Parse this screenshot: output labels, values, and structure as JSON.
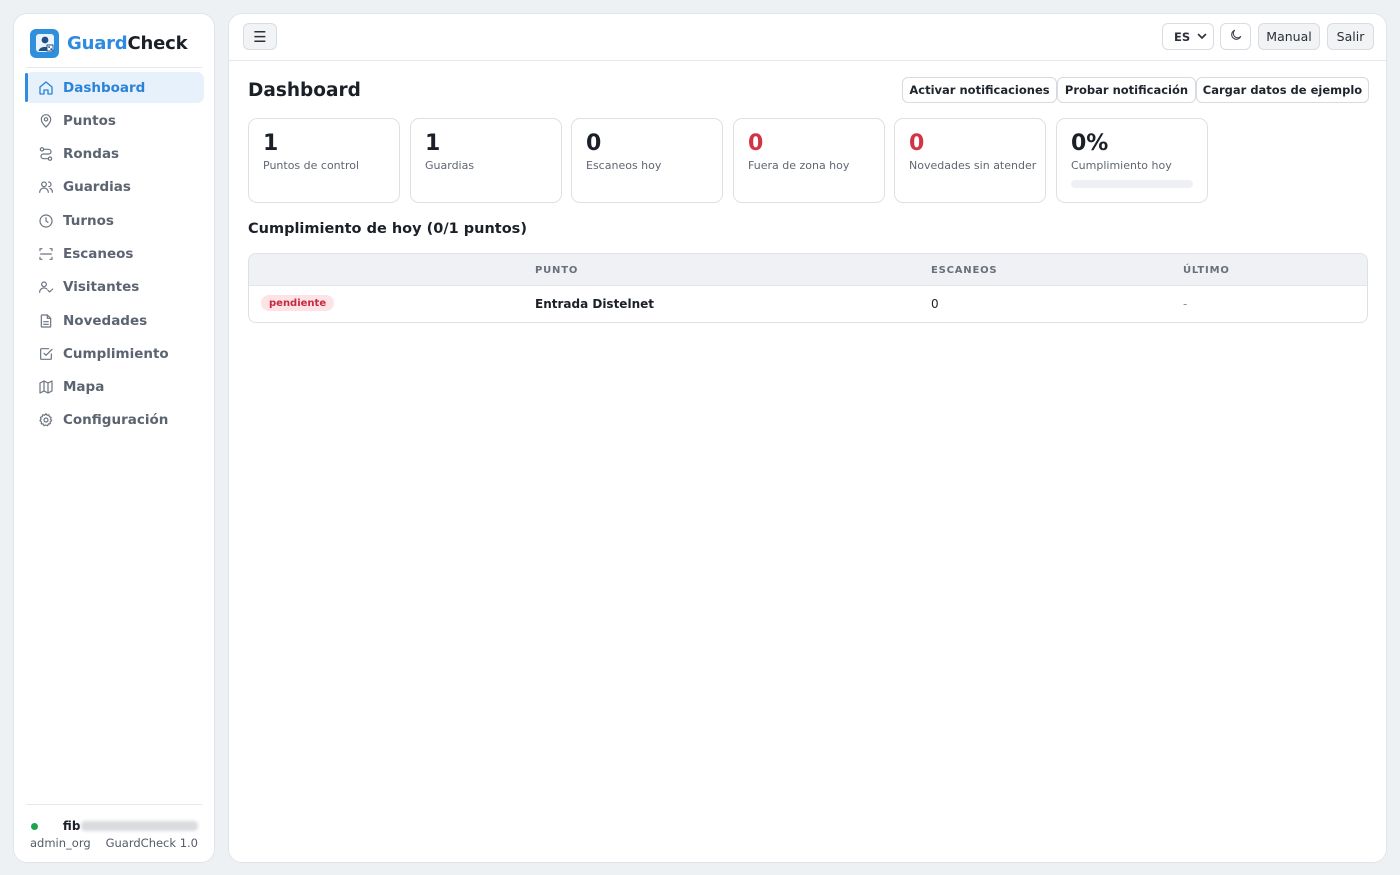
{
  "app": {
    "brand_primary": "Guard",
    "brand_secondary": "Check",
    "accent_color": "#2e8be0",
    "danger_color": "#d23446",
    "success_color": "#1ea44f"
  },
  "sidebar": {
    "items": [
      {
        "label": "Dashboard",
        "icon": "home-icon",
        "active": true
      },
      {
        "label": "Puntos",
        "icon": "map-pin-icon",
        "active": false
      },
      {
        "label": "Rondas",
        "icon": "route-icon",
        "active": false
      },
      {
        "label": "Guardias",
        "icon": "users-icon",
        "active": false
      },
      {
        "label": "Turnos",
        "icon": "clock-icon",
        "active": false
      },
      {
        "label": "Escaneos",
        "icon": "scan-icon",
        "active": false
      },
      {
        "label": "Visitantes",
        "icon": "user-check-icon",
        "active": false
      },
      {
        "label": "Novedades",
        "icon": "document-icon",
        "active": false
      },
      {
        "label": "Cumplimiento",
        "icon": "checkbox-icon",
        "active": false
      },
      {
        "label": "Mapa",
        "icon": "map-icon",
        "active": false
      },
      {
        "label": "Configuración",
        "icon": "gear-icon",
        "active": false
      }
    ],
    "footer": {
      "user_name": "fib",
      "role": "admin_org",
      "version": "GuardCheck 1.0"
    }
  },
  "topbar": {
    "menu_icon": "☰",
    "language": "ES",
    "theme_icon": "moon-icon",
    "manual_label": "Manual",
    "logout_label": "Salir"
  },
  "page": {
    "title": "Dashboard",
    "actions": {
      "enable_notifications": "Activar notificaciones",
      "test_notification": "Probar notificación",
      "load_sample": "Cargar datos de ejemplo"
    }
  },
  "stats": [
    {
      "value": "1",
      "label": "Puntos de control",
      "highlight": false
    },
    {
      "value": "1",
      "label": "Guardias",
      "highlight": false
    },
    {
      "value": "0",
      "label": "Escaneos hoy",
      "highlight": false
    },
    {
      "value": "0",
      "label": "Fuera de zona hoy",
      "highlight": true
    },
    {
      "value": "0",
      "label": "Novedades sin atender",
      "highlight": true
    },
    {
      "value": "0%",
      "label": "Cumplimiento hoy",
      "highlight": false,
      "progress": 0
    }
  ],
  "compliance": {
    "title": "Cumplimiento de hoy (0/1 puntos)",
    "columns": [
      "",
      "PUNTO",
      "ESCANEOS",
      "ÚLTIMO"
    ],
    "rows": [
      {
        "status": "pendiente",
        "point": "Entrada Distelnet",
        "scans": "0",
        "last": "-"
      }
    ]
  }
}
